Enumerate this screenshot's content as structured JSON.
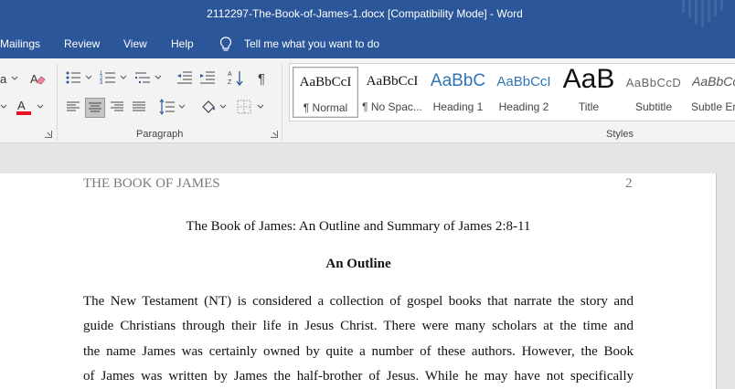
{
  "window": {
    "title": "2112297-The-Book-of-James-1.docx [Compatibility Mode]  -  Word"
  },
  "tabs": [
    {
      "label": "Mailings"
    },
    {
      "label": "Review"
    },
    {
      "label": "View"
    },
    {
      "label": "Help"
    }
  ],
  "tell_me": {
    "label": "Tell me what you want to do"
  },
  "ribbon": {
    "paragraph_label": "Paragraph",
    "styles_label": "Styles",
    "styles": [
      {
        "sample": "AaBbCcI",
        "name": "¶ Normal"
      },
      {
        "sample": "AaBbCcI",
        "name": "¶ No Spac..."
      },
      {
        "sample": "AaBbC",
        "name": "Heading 1"
      },
      {
        "sample": "AaBbCcI",
        "name": "Heading 2"
      },
      {
        "sample": "AaB",
        "name": "Title"
      },
      {
        "sample": "AaBbCcD",
        "name": "Subtitle"
      },
      {
        "sample": "AaBbCcI",
        "name": "Subtle Em..."
      }
    ],
    "colors": {
      "font_color_bar": "#e81123",
      "accent": "#2b579a"
    }
  },
  "document": {
    "running_head": "THE BOOK OF JAMES",
    "page_number": "2",
    "title": "The Book of James: An Outline and Summary of James 2:8-11",
    "heading": "An Outline",
    "lines": [
      "The New Testament (NT) is considered a collection of gospel books that narrate the story and",
      "guide Christians through their life in Jesus Christ. There were many scholars at the time and",
      "the name James was certainly owned by quite a number of these authors. However, the Book",
      "of James was written by James the half-brother of Jesus. While he may have not specifically"
    ]
  }
}
